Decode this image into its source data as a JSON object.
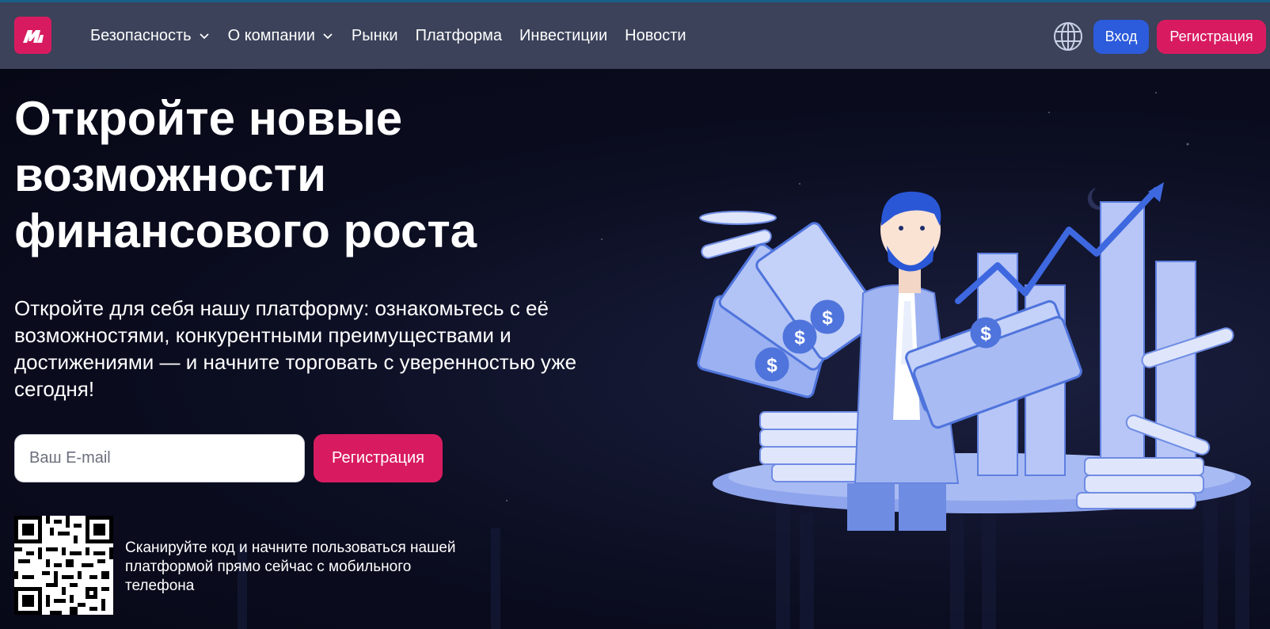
{
  "header": {
    "logo_alt": "logo",
    "nav": [
      {
        "label": "Безопасность",
        "has_dropdown": true
      },
      {
        "label": "О компании",
        "has_dropdown": true
      },
      {
        "label": "Рынки",
        "has_dropdown": false
      },
      {
        "label": "Платформа",
        "has_dropdown": false
      },
      {
        "label": "Инвестиции",
        "has_dropdown": false
      },
      {
        "label": "Новости",
        "has_dropdown": false
      }
    ],
    "login_label": "Вход",
    "register_label": "Регистрация"
  },
  "hero": {
    "title": "Откройте новые возможности финансового роста",
    "lead": "Откройте для себя нашу платформу: ознакомьтесь с её возможностями, конкурентными преимуществами и достижениями — и начните торговать с уверенностью уже сегодня!",
    "email_placeholder": "Ваш E-mail",
    "register_label": "Регистрация",
    "qr_text": "Сканируйте код и начните пользоваться нашей платформой прямо сейчас с мобильного телефона"
  },
  "colors": {
    "accent_pink": "#d81b60",
    "accent_blue": "#2c5bdb",
    "header_bg": "#3b4259",
    "page_bg": "#0a0c1e"
  },
  "icons": {
    "globe": "globe-icon",
    "chevron": "chevron-down-icon",
    "logo": "logo-icon"
  }
}
